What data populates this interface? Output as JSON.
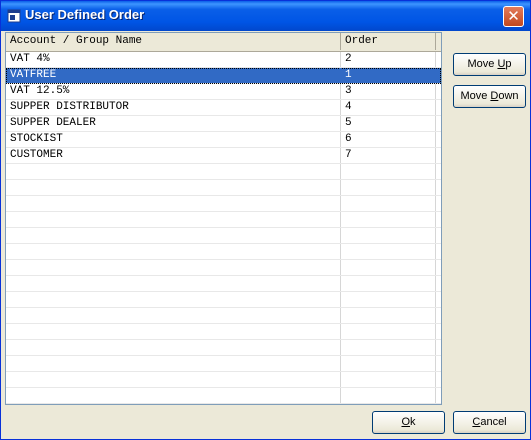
{
  "window": {
    "title": "User Defined Order"
  },
  "grid": {
    "columns": [
      "Account / Group Name",
      "Order"
    ],
    "rows": [
      {
        "name": "VAT 4%",
        "order": "2"
      },
      {
        "name": "VATFREE",
        "order": "1"
      },
      {
        "name": "VAT 12.5%",
        "order": "3"
      },
      {
        "name": "SUPPER DISTRIBUTOR",
        "order": "4"
      },
      {
        "name": "SUPPER DEALER",
        "order": "5"
      },
      {
        "name": "STOCKIST",
        "order": "6"
      },
      {
        "name": "CUSTOMER",
        "order": "7"
      }
    ],
    "selected_index": 1,
    "selection_color": "#316ac5"
  },
  "buttons": {
    "move_up": {
      "pre": "Move ",
      "accel": "U",
      "post": "p"
    },
    "move_down": {
      "pre": "Move ",
      "accel": "D",
      "post": "own"
    },
    "ok": {
      "pre": "",
      "accel": "O",
      "post": "k"
    },
    "cancel": {
      "pre": "",
      "accel": "C",
      "post": "ancel"
    }
  },
  "icons": {
    "title": "app-window-icon",
    "close": "close-icon"
  }
}
